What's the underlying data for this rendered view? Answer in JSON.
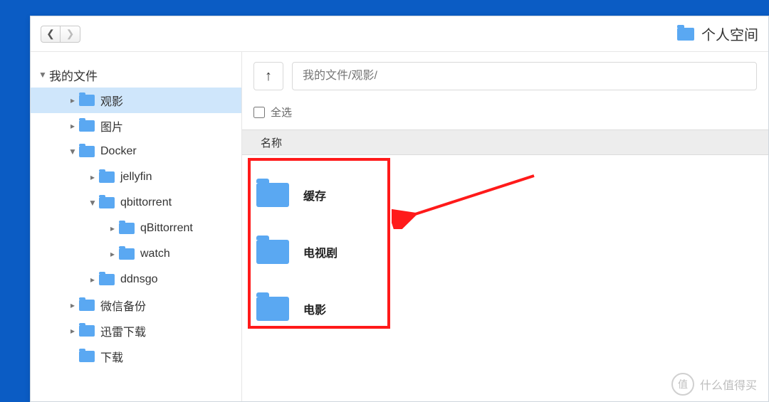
{
  "header": {
    "space_title": "个人空间"
  },
  "sidebar": {
    "root": {
      "label": "我的文件",
      "expanded": true
    },
    "items": [
      {
        "label": "观影",
        "level": 1,
        "expanded": false,
        "selected": true
      },
      {
        "label": "图片",
        "level": 1,
        "expanded": false,
        "selected": false
      },
      {
        "label": "Docker",
        "level": 1,
        "expanded": true,
        "selected": false
      },
      {
        "label": "jellyfin",
        "level": 2,
        "expanded": false,
        "selected": false
      },
      {
        "label": "qbittorrent",
        "level": 2,
        "expanded": true,
        "selected": false
      },
      {
        "label": "qBittorrent",
        "level": 3,
        "expanded": false,
        "selected": false
      },
      {
        "label": "watch",
        "level": 3,
        "expanded": false,
        "selected": false
      },
      {
        "label": "ddnsgo",
        "level": 2,
        "expanded": false,
        "selected": false
      },
      {
        "label": "微信备份",
        "level": 1,
        "expanded": false,
        "selected": false
      },
      {
        "label": "迅雷下载",
        "level": 1,
        "expanded": false,
        "selected": false
      },
      {
        "label": "下载",
        "level": 1,
        "expanded": false,
        "selected": false,
        "leaf": true
      }
    ]
  },
  "main": {
    "path_placeholder": "我的文件/观影/",
    "select_all_label": "全选",
    "column_header": "名称",
    "folders": [
      {
        "name": "缓存"
      },
      {
        "name": "电视剧"
      },
      {
        "name": "电影"
      }
    ]
  },
  "watermark": {
    "badge": "值",
    "text": "什么值得买"
  }
}
